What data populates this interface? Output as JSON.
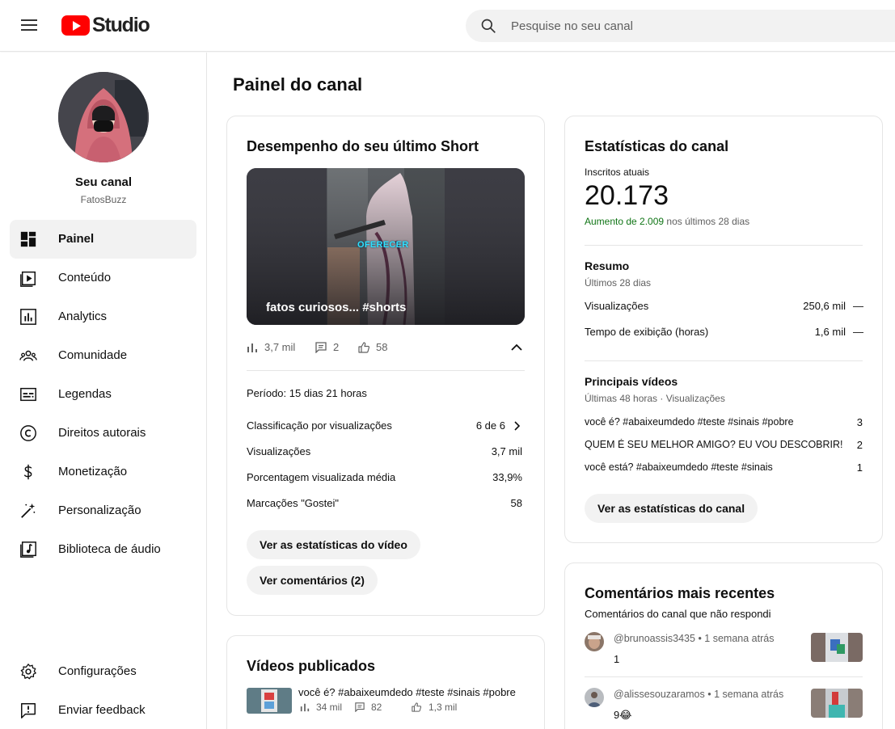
{
  "header": {
    "logo_text": "Studio",
    "search_placeholder": "Pesquise no seu canal"
  },
  "sidebar": {
    "channel_title": "Seu canal",
    "channel_handle": "FatosBuzz",
    "items": [
      {
        "label": "Painel",
        "icon": "dashboard-icon",
        "active": true
      },
      {
        "label": "Conteúdo",
        "icon": "content-icon"
      },
      {
        "label": "Analytics",
        "icon": "analytics-icon"
      },
      {
        "label": "Comunidade",
        "icon": "community-icon"
      },
      {
        "label": "Legendas",
        "icon": "subtitles-icon"
      },
      {
        "label": "Direitos autorais",
        "icon": "copyright-icon"
      },
      {
        "label": "Monetização",
        "icon": "monetization-icon"
      },
      {
        "label": "Personalização",
        "icon": "customization-icon"
      },
      {
        "label": "Biblioteca de áudio",
        "icon": "audio-library-icon"
      }
    ],
    "bottom_items": [
      {
        "label": "Configurações",
        "icon": "settings-icon"
      },
      {
        "label": "Enviar feedback",
        "icon": "feedback-icon"
      }
    ]
  },
  "main": {
    "page_title": "Painel do canal",
    "short_card": {
      "title": "Desempenho do seu último Short",
      "thumb_title": "fatos curiosos... #shorts",
      "thumb_overlay_text": "OFERECER",
      "views": "3,7 mil",
      "comments": "2",
      "likes": "58",
      "period": "Período: 15 dias 21 horas",
      "rows": [
        {
          "label": "Classificação por visualizações",
          "value": "6 de 6"
        },
        {
          "label": "Visualizações",
          "value": "3,7 mil"
        },
        {
          "label": "Porcentagem visualizada média",
          "value": "33,9%"
        },
        {
          "label": "Marcações \"Gostei\"",
          "value": "58"
        }
      ],
      "btn_stats": "Ver as estatísticas do vídeo",
      "btn_comments": "Ver comentários (2)"
    },
    "published_card": {
      "title": "Vídeos publicados",
      "video_title": "você é? #abaixeumdedo #teste #sinais #pobre",
      "views": "34 mil",
      "comments": "82",
      "likes": "1,3 mil"
    },
    "stats_card": {
      "title": "Estatísticas do canal",
      "subs_label": "Inscritos atuais",
      "subs_value": "20.173",
      "growth_highlight": "Aumento de 2.009",
      "growth_rest": "nos últimos 28 dias",
      "summary_title": "Resumo",
      "summary_sub": "Últimos 28 dias",
      "summary_rows": [
        {
          "label": "Visualizações",
          "value": "250,6 mil",
          "trend": "—"
        },
        {
          "label": "Tempo de exibição (horas)",
          "value": "1,6 mil",
          "trend": "—"
        }
      ],
      "top_title": "Principais vídeos",
      "top_sub": "Últimas 48 horas · Visualizações",
      "top_rows": [
        {
          "label": "você é? #abaixeumdedo #teste #sinais #pobre",
          "value": "3"
        },
        {
          "label": "QUEM É SEU MELHOR AMIGO? EU VOU DESCOBRIR! ...",
          "value": "2"
        },
        {
          "label": "você está? #abaixeumdedo #teste #sinais",
          "value": "1"
        }
      ],
      "btn": "Ver as estatísticas do canal"
    },
    "comments_card": {
      "title": "Comentários mais recentes",
      "sub": "Comentários do canal que não respondi",
      "comments": [
        {
          "author": "@brunoassis3435",
          "time": "• 1 semana atrás",
          "text": "1"
        },
        {
          "author": "@alissesouzaramos",
          "time": "• 1 semana atrás",
          "text": "9😂"
        }
      ]
    }
  },
  "colors": {
    "accent_red": "#ff0000",
    "growth_green": "#107516",
    "muted_text": "#606060",
    "chip_bg": "#f2f2f2"
  }
}
